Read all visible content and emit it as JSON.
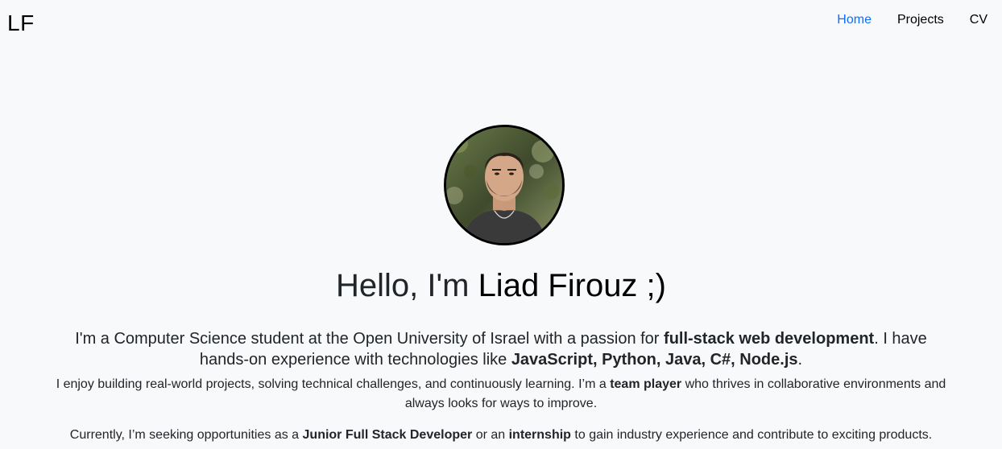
{
  "nav": {
    "brand": "LF",
    "links": [
      {
        "label": "Home",
        "active": true
      },
      {
        "label": "Projects",
        "active": false
      },
      {
        "label": "CV",
        "active": false
      }
    ]
  },
  "hero": {
    "greeting": "Hello, I'm ",
    "name": "Liad Firouz ;)",
    "avatar_alt": "Profile photo"
  },
  "intro": {
    "lead_1": "I'm a Computer Science student at the Open University of Israel with a passion for ",
    "lead_bold_1": "full-stack web development",
    "lead_2": ". I have hands-on experience with technologies like ",
    "lead_bold_2": "JavaScript, Python, Java, C#, Node.js",
    "lead_3": ".",
    "p1_1": "I enjoy building real-world projects, solving technical challenges, and continuously learning. I’m a ",
    "p1_bold": "team player",
    "p1_2": " who thrives in collaborative environments and always looks for ways to improve.",
    "p2_1": "Currently, I’m seeking opportunities as a ",
    "p2_bold_1": "Junior Full Stack Developer",
    "p2_2": " or an ",
    "p2_bold_2": "internship",
    "p2_3": " to gain industry experience and contribute to exciting products."
  },
  "colors": {
    "background": "#f8f9fa",
    "accent": "#0d6efd",
    "text": "#212529"
  }
}
